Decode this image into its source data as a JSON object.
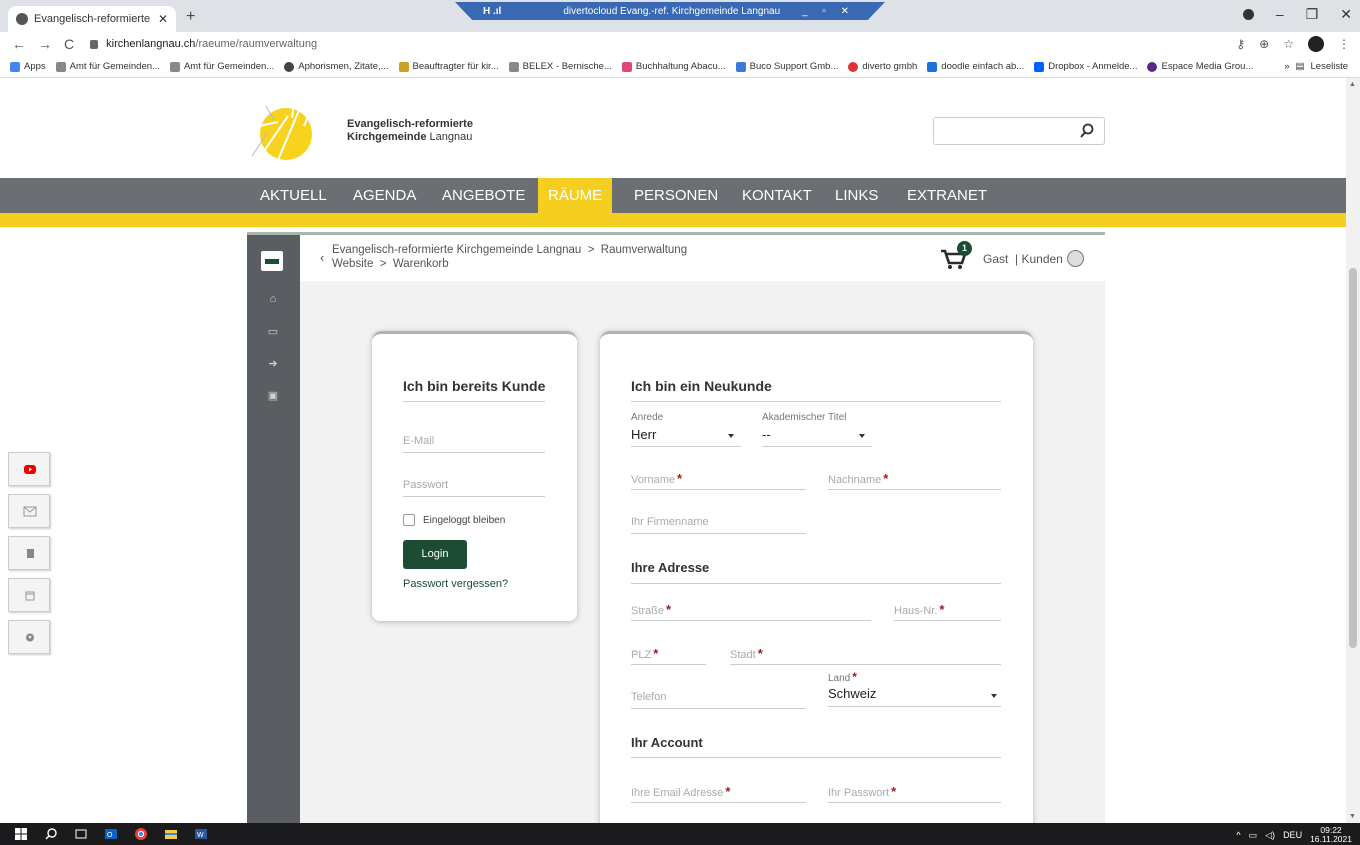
{
  "browser": {
    "tab_title": "Evangelisch-reformierte Kirchgem",
    "url_host": "kirchenlangnau.ch",
    "url_path": "/raeume/raumverwaltung",
    "remote_title": "divertocloud Evang.-ref. Kirchgemeinde Langnau",
    "bookmarks": [
      "Apps",
      "Amt für Gemeinden...",
      "Amt für Gemeinden...",
      "Aphorismen, Zitate,...",
      "Beauftragter für kir...",
      "BELEX - Bernische...",
      "Buchhaltung Abacu...",
      "Buco Support Gmb...",
      "diverto gmbh",
      "doodle einfach ab...",
      "Dropbox - Anmelde...",
      "Espace Media Grou..."
    ],
    "reading_list": "Leseliste"
  },
  "site": {
    "logo_line1": "Evangelisch-reformierte",
    "logo_line2_bold": "Kirchgemeinde",
    "logo_line2_light": "Langnau",
    "search_placeholder": "",
    "nav": [
      "AKTUELL",
      "AGENDA",
      "ANGEBOTE",
      "RÄUME",
      "PERSONEN",
      "KONTAKT",
      "LINKS",
      "EXTRANET"
    ],
    "nav_active": "RÄUME"
  },
  "app": {
    "breadcrumb_line1": "Evangelisch-reformierte Kirchgemeinde Langnau  >  Raumverwaltung",
    "breadcrumb_line2": "Website  >  Warenkorb",
    "cart_count": "1",
    "user_label": "Gast  | Kunden"
  },
  "login": {
    "title": "Ich bin bereits Kunde",
    "email_placeholder": "E-Mail",
    "password_placeholder": "Passwort",
    "remember_label": "Eingeloggt bleiben",
    "login_button": "Login",
    "forgot_link": "Passwort vergessen?"
  },
  "register": {
    "title": "Ich bin ein Neukunde",
    "salutation_label": "Anrede",
    "salutation_value": "Herr",
    "title_label": "Akademischer Titel",
    "title_value": "--",
    "firstname_placeholder": "Vorname",
    "lastname_placeholder": "Nachname",
    "company_placeholder": "Ihr Firmenname",
    "address_section": "Ihre Adresse",
    "street_placeholder": "Straße",
    "houseno_placeholder": "Haus-Nr.",
    "zip_placeholder": "PLZ",
    "city_placeholder": "Stadt",
    "phone_placeholder": "Telefon",
    "country_label": "Land",
    "country_value": "Schweiz",
    "account_section": "Ihr Account",
    "email_placeholder": "Ihre Email Adresse",
    "password_placeholder": "Ihr Passwort",
    "required_mark": "*"
  },
  "taskbar": {
    "language": "DEU",
    "time": "09:22",
    "date": "16.11.2021"
  },
  "colors": {
    "accent_green": "#1d4c35",
    "nav_gray": "#6b6e73",
    "brand_yellow": "#f5cf1f"
  }
}
